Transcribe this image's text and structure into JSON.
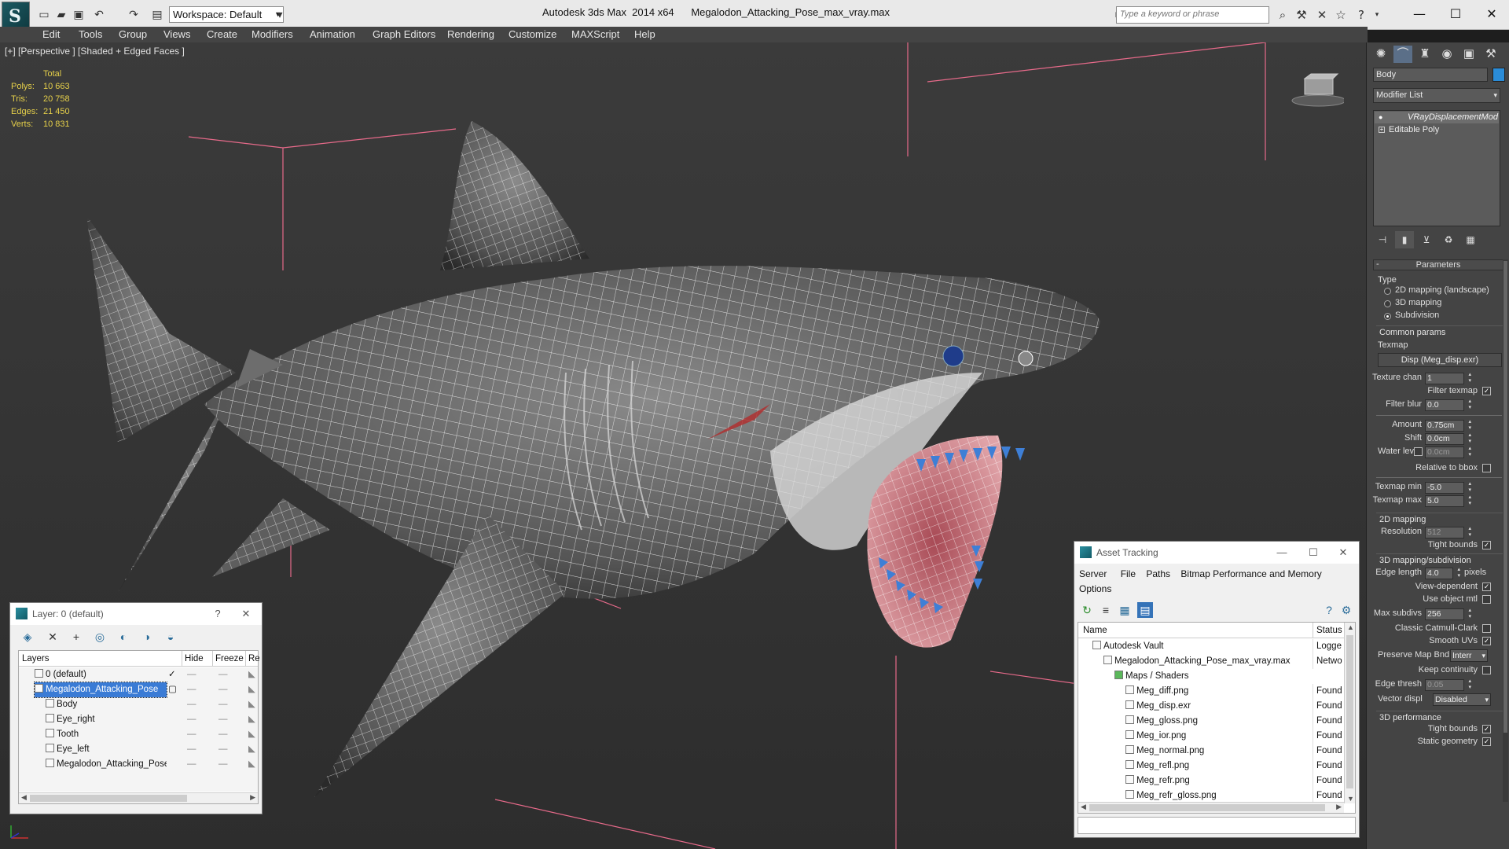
{
  "titlebar": {
    "logo_text": "S",
    "workspace": "Workspace: Default",
    "app_name": "Autodesk 3ds Max  2014 x64",
    "file_name": "Megalodon_Attacking_Pose_max_vray.max",
    "search_placeholder": "Type a keyword or phrase",
    "icons": [
      "new-file-icon",
      "open-folder-icon",
      "save-icon",
      "undo-icon",
      "redo-icon",
      "project-folder-icon",
      "binoculars-icon",
      "tools-icon",
      "exchange-icon",
      "favorites-star-icon",
      "help-icon"
    ]
  },
  "menu": [
    "Edit",
    "Tools",
    "Group",
    "Views",
    "Create",
    "Modifiers",
    "Animation",
    "Graph Editors",
    "Rendering",
    "Customize",
    "MAXScript",
    "Help"
  ],
  "viewport": {
    "label": "[+] [Perspective ] [Shaded + Edged Faces ]",
    "stats": {
      "header": "Total",
      "rows": [
        {
          "label": "Polys:",
          "value": "10 663"
        },
        {
          "label": "Tris:",
          "value": "20 758"
        },
        {
          "label": "Edges:",
          "value": "21 450"
        },
        {
          "label": "Verts:",
          "value": "10 831"
        }
      ]
    }
  },
  "command_panel": {
    "object_name": "Body",
    "object_color": "#2a8cd8",
    "modifier_list": "Modifier List",
    "stack": [
      "VRayDisplacementMod",
      "Editable Poly"
    ],
    "parameters": {
      "title": "Parameters",
      "type_label": "Type",
      "type_options": [
        "2D mapping (landscape)",
        "3D mapping",
        "Subdivision"
      ],
      "type_selected": 2,
      "common_label": "Common params",
      "texmap_label": "Texmap",
      "texmap_button": "Disp (Meg_disp.exr)",
      "texture_chan_label": "Texture chan",
      "texture_chan": "1",
      "filter_texmap_label": "Filter texmap",
      "filter_blur_label": "Filter blur",
      "filter_blur": "0.0",
      "amount_label": "Amount",
      "amount": "0.75cm",
      "shift_label": "Shift",
      "shift": "0.0cm",
      "water_level_label": "Water level",
      "water_level": "0.0cm",
      "relative_bbox_label": "Relative to bbox",
      "texmap_min_label": "Texmap min",
      "texmap_min": "-5.0",
      "texmap_max_label": "Texmap max",
      "texmap_max": "5.0",
      "mapping2d_label": "2D mapping",
      "resolution_label": "Resolution",
      "resolution": "512",
      "tight_bounds_label": "Tight bounds",
      "mapping3d_label": "3D mapping/subdivision",
      "edge_length_label": "Edge length",
      "edge_length": "4.0",
      "edge_length_unit": "pixels",
      "view_dependent_label": "View-dependent",
      "use_object_mtl_label": "Use object mtl",
      "max_subdivs_label": "Max subdivs",
      "max_subdivs": "256",
      "classic_catmull_label": "Classic Catmull-Clark",
      "smooth_uvs_label": "Smooth UVs",
      "preserve_map_label": "Preserve Map Bnd",
      "preserve_map_value": "Interr",
      "keep_continuity_label": "Keep continuity",
      "edge_thresh_label": "Edge thresh",
      "edge_thresh": "0.05",
      "vector_displ_label": "Vector displ",
      "vector_displ_value": "Disabled",
      "performance_label": "3D performance",
      "tight_bounds2_label": "Tight bounds",
      "static_geometry_label": "Static geometry"
    }
  },
  "layer_window": {
    "title": "Layer: 0 (default)",
    "help": "?",
    "close": "✕",
    "columns": [
      "Layers",
      "Hide",
      "Freeze",
      "Ren"
    ],
    "rows": [
      {
        "name": "0 (default)",
        "indent": 1,
        "selected": false,
        "active": true
      },
      {
        "name": "Megalodon_Attacking_Pose",
        "indent": 1,
        "selected": true,
        "active": false
      },
      {
        "name": "Body",
        "indent": 2,
        "selected": false,
        "active": false
      },
      {
        "name": "Eye_right",
        "indent": 2,
        "selected": false,
        "active": false
      },
      {
        "name": "Tooth",
        "indent": 2,
        "selected": false,
        "active": false
      },
      {
        "name": "Eye_left",
        "indent": 2,
        "selected": false,
        "active": false
      },
      {
        "name": "Megalodon_Attacking_Pose",
        "indent": 2,
        "selected": false,
        "active": false
      }
    ]
  },
  "asset_window": {
    "title": "Asset Tracking",
    "menu": [
      "Server",
      "File",
      "Paths",
      "Bitmap Performance and Memory",
      "Options"
    ],
    "columns": [
      "Name",
      "Status"
    ],
    "rows": [
      {
        "name": "Autodesk Vault",
        "indent": 1,
        "status": "Logge"
      },
      {
        "name": "Megalodon_Attacking_Pose_max_vray.max",
        "indent": 2,
        "status": "Netwo"
      },
      {
        "name": "Maps / Shaders",
        "indent": 3,
        "status": ""
      },
      {
        "name": "Meg_diff.png",
        "indent": 4,
        "status": "Found"
      },
      {
        "name": "Meg_disp.exr",
        "indent": 4,
        "status": "Found"
      },
      {
        "name": "Meg_gloss.png",
        "indent": 4,
        "status": "Found"
      },
      {
        "name": "Meg_ior.png",
        "indent": 4,
        "status": "Found"
      },
      {
        "name": "Meg_normal.png",
        "indent": 4,
        "status": "Found"
      },
      {
        "name": "Meg_refl.png",
        "indent": 4,
        "status": "Found"
      },
      {
        "name": "Meg_refr.png",
        "indent": 4,
        "status": "Found"
      },
      {
        "name": "Meg_refr_gloss.png",
        "indent": 4,
        "status": "Found"
      }
    ]
  }
}
